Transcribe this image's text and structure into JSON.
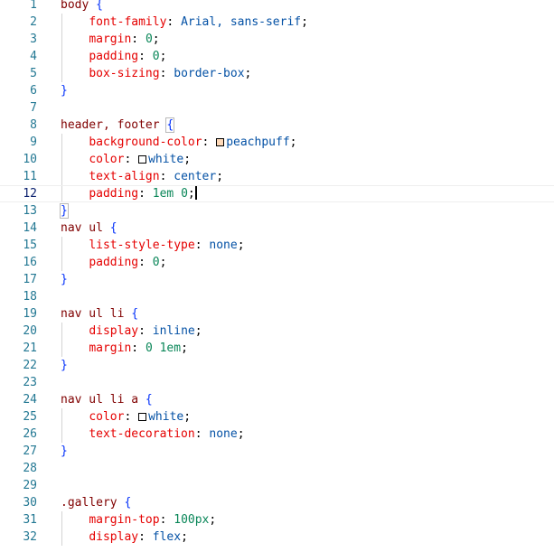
{
  "editor": {
    "language": "css",
    "current_line": 12,
    "colors": {
      "selector": "#800000",
      "property": "#e50000",
      "value": "#0451a5",
      "number": "#098658",
      "brace": "#0431fa",
      "line_number": "#237893",
      "active_line_number": "#0b216f"
    },
    "lines": [
      {
        "n": 1,
        "tokens": [
          {
            "t": "sel",
            "v": "body"
          },
          {
            "t": "plain",
            "v": " "
          },
          {
            "t": "brace",
            "v": "{"
          }
        ]
      },
      {
        "n": 2,
        "tokens": [
          {
            "t": "plain",
            "v": "    "
          },
          {
            "t": "prop",
            "v": "font-family"
          },
          {
            "t": "punct",
            "v": ": "
          },
          {
            "t": "val",
            "v": "Arial, sans-serif"
          },
          {
            "t": "punct",
            "v": ";"
          }
        ]
      },
      {
        "n": 3,
        "tokens": [
          {
            "t": "plain",
            "v": "    "
          },
          {
            "t": "prop",
            "v": "margin"
          },
          {
            "t": "punct",
            "v": ": "
          },
          {
            "t": "num",
            "v": "0"
          },
          {
            "t": "punct",
            "v": ";"
          }
        ]
      },
      {
        "n": 4,
        "tokens": [
          {
            "t": "plain",
            "v": "    "
          },
          {
            "t": "prop",
            "v": "padding"
          },
          {
            "t": "punct",
            "v": ": "
          },
          {
            "t": "num",
            "v": "0"
          },
          {
            "t": "punct",
            "v": ";"
          }
        ]
      },
      {
        "n": 5,
        "tokens": [
          {
            "t": "plain",
            "v": "    "
          },
          {
            "t": "prop",
            "v": "box-sizing"
          },
          {
            "t": "punct",
            "v": ": "
          },
          {
            "t": "val",
            "v": "border-box"
          },
          {
            "t": "punct",
            "v": ";"
          }
        ]
      },
      {
        "n": 6,
        "tokens": [
          {
            "t": "brace",
            "v": "}"
          }
        ]
      },
      {
        "n": 7,
        "tokens": []
      },
      {
        "n": 8,
        "tokens": [
          {
            "t": "sel",
            "v": "header, footer"
          },
          {
            "t": "plain",
            "v": " "
          },
          {
            "t": "brace",
            "v": "{",
            "matched": true
          }
        ]
      },
      {
        "n": 9,
        "tokens": [
          {
            "t": "plain",
            "v": "    "
          },
          {
            "t": "prop",
            "v": "background-color"
          },
          {
            "t": "punct",
            "v": ": "
          },
          {
            "t": "swatch",
            "v": "#ffdab9"
          },
          {
            "t": "val",
            "v": "peachpuff"
          },
          {
            "t": "punct",
            "v": ";"
          }
        ]
      },
      {
        "n": 10,
        "tokens": [
          {
            "t": "plain",
            "v": "    "
          },
          {
            "t": "prop",
            "v": "color"
          },
          {
            "t": "punct",
            "v": ": "
          },
          {
            "t": "swatch",
            "v": "#ffffff"
          },
          {
            "t": "val",
            "v": "white"
          },
          {
            "t": "punct",
            "v": ";"
          }
        ]
      },
      {
        "n": 11,
        "tokens": [
          {
            "t": "plain",
            "v": "    "
          },
          {
            "t": "prop",
            "v": "text-align"
          },
          {
            "t": "punct",
            "v": ": "
          },
          {
            "t": "val",
            "v": "center"
          },
          {
            "t": "punct",
            "v": ";"
          }
        ]
      },
      {
        "n": 12,
        "tokens": [
          {
            "t": "plain",
            "v": "    "
          },
          {
            "t": "prop",
            "v": "padding"
          },
          {
            "t": "punct",
            "v": ": "
          },
          {
            "t": "num",
            "v": "1em"
          },
          {
            "t": "plain",
            "v": " "
          },
          {
            "t": "num",
            "v": "0"
          },
          {
            "t": "punct",
            "v": ";"
          },
          {
            "t": "cursor",
            "v": ""
          }
        ]
      },
      {
        "n": 13,
        "tokens": [
          {
            "t": "brace",
            "v": "}",
            "matched": true
          }
        ]
      },
      {
        "n": 14,
        "tokens": [
          {
            "t": "sel",
            "v": "nav ul"
          },
          {
            "t": "plain",
            "v": " "
          },
          {
            "t": "brace",
            "v": "{"
          }
        ]
      },
      {
        "n": 15,
        "tokens": [
          {
            "t": "plain",
            "v": "    "
          },
          {
            "t": "prop",
            "v": "list-style-type"
          },
          {
            "t": "punct",
            "v": ": "
          },
          {
            "t": "val",
            "v": "none"
          },
          {
            "t": "punct",
            "v": ";"
          }
        ]
      },
      {
        "n": 16,
        "tokens": [
          {
            "t": "plain",
            "v": "    "
          },
          {
            "t": "prop",
            "v": "padding"
          },
          {
            "t": "punct",
            "v": ": "
          },
          {
            "t": "num",
            "v": "0"
          },
          {
            "t": "punct",
            "v": ";"
          }
        ]
      },
      {
        "n": 17,
        "tokens": [
          {
            "t": "brace",
            "v": "}"
          }
        ]
      },
      {
        "n": 18,
        "tokens": []
      },
      {
        "n": 19,
        "tokens": [
          {
            "t": "sel",
            "v": "nav ul li"
          },
          {
            "t": "plain",
            "v": " "
          },
          {
            "t": "brace",
            "v": "{"
          }
        ]
      },
      {
        "n": 20,
        "tokens": [
          {
            "t": "plain",
            "v": "    "
          },
          {
            "t": "prop",
            "v": "display"
          },
          {
            "t": "punct",
            "v": ": "
          },
          {
            "t": "val",
            "v": "inline"
          },
          {
            "t": "punct",
            "v": ";"
          }
        ]
      },
      {
        "n": 21,
        "tokens": [
          {
            "t": "plain",
            "v": "    "
          },
          {
            "t": "prop",
            "v": "margin"
          },
          {
            "t": "punct",
            "v": ": "
          },
          {
            "t": "num",
            "v": "0"
          },
          {
            "t": "plain",
            "v": " "
          },
          {
            "t": "num",
            "v": "1em"
          },
          {
            "t": "punct",
            "v": ";"
          }
        ]
      },
      {
        "n": 22,
        "tokens": [
          {
            "t": "brace",
            "v": "}"
          }
        ]
      },
      {
        "n": 23,
        "tokens": []
      },
      {
        "n": 24,
        "tokens": [
          {
            "t": "sel",
            "v": "nav ul li a"
          },
          {
            "t": "plain",
            "v": " "
          },
          {
            "t": "brace",
            "v": "{"
          }
        ]
      },
      {
        "n": 25,
        "tokens": [
          {
            "t": "plain",
            "v": "    "
          },
          {
            "t": "prop",
            "v": "color"
          },
          {
            "t": "punct",
            "v": ": "
          },
          {
            "t": "swatch",
            "v": "#ffffff"
          },
          {
            "t": "val",
            "v": "white"
          },
          {
            "t": "punct",
            "v": ";"
          }
        ]
      },
      {
        "n": 26,
        "tokens": [
          {
            "t": "plain",
            "v": "    "
          },
          {
            "t": "prop",
            "v": "text-decoration"
          },
          {
            "t": "punct",
            "v": ": "
          },
          {
            "t": "val",
            "v": "none"
          },
          {
            "t": "punct",
            "v": ";"
          }
        ]
      },
      {
        "n": 27,
        "tokens": [
          {
            "t": "brace",
            "v": "}"
          }
        ]
      },
      {
        "n": 28,
        "tokens": []
      },
      {
        "n": 29,
        "tokens": []
      },
      {
        "n": 30,
        "tokens": [
          {
            "t": "sel",
            "v": ".gallery"
          },
          {
            "t": "plain",
            "v": " "
          },
          {
            "t": "brace",
            "v": "{"
          }
        ]
      },
      {
        "n": 31,
        "tokens": [
          {
            "t": "plain",
            "v": "    "
          },
          {
            "t": "prop",
            "v": "margin-top"
          },
          {
            "t": "punct",
            "v": ": "
          },
          {
            "t": "num",
            "v": "100px"
          },
          {
            "t": "punct",
            "v": ";"
          }
        ]
      },
      {
        "n": 32,
        "tokens": [
          {
            "t": "plain",
            "v": "    "
          },
          {
            "t": "prop",
            "v": "display"
          },
          {
            "t": "punct",
            "v": ": "
          },
          {
            "t": "val",
            "v": "flex"
          },
          {
            "t": "punct",
            "v": ";"
          }
        ]
      }
    ]
  }
}
